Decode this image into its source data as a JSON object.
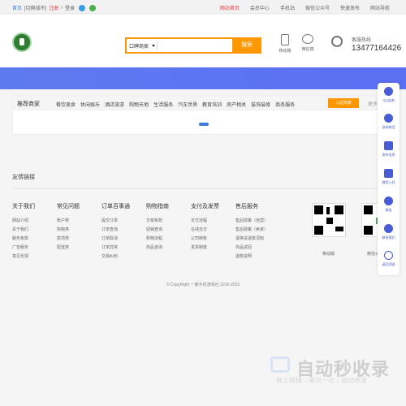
{
  "topbar": {
    "home": "首页",
    "city": "[切换城市]",
    "register": "注册",
    "login": "登录",
    "slash": "/",
    "right": [
      "网站首页",
      "会员中心",
      "手机站",
      "微信公众号",
      "快速发布",
      "网站导航"
    ],
    "colors": {
      "red": "#e4393c",
      "blue": "#3a7bd5"
    }
  },
  "header": {
    "search_select": "口碑商家",
    "search_placeholder": "",
    "search_button": "搜索",
    "apps": [
      {
        "label": "移动端"
      },
      {
        "label": "微信端"
      }
    ],
    "hotline_label": "客服热线",
    "hotline_number": "13477164426",
    "accent": "#ff9800"
  },
  "shops": {
    "title": "推荐商家",
    "categories": [
      "餐饮美食",
      "休闲娱乐",
      "酒店旅游",
      "购物天地",
      "生活服务",
      "汽车世界",
      "教育培训",
      "房产相关",
      "装饰装修",
      "商务服务"
    ],
    "join": "入驻商家",
    "more": "更多"
  },
  "footer": {
    "friend_links": "友情链接",
    "columns": [
      {
        "h": "关于我们",
        "items": [
          "网站介绍",
          "关于我们",
          "服务条款",
          "广告服务",
          "意见反馈"
        ]
      },
      {
        "h": "常见问题",
        "items": [
          "账户类",
          "购物类",
          "款项类",
          "配送类"
        ]
      },
      {
        "h": "订单百事通",
        "items": [
          "提交订单",
          "订单查询",
          "订单取消",
          "订单异常",
          "交易纠纷"
        ]
      },
      {
        "h": "购物指南",
        "items": [
          "交易条款",
          "促销查询",
          "购物流程",
          "商品咨询"
        ]
      },
      {
        "h": "支付及发票",
        "items": [
          "支付流程",
          "在线支付",
          "公司转账",
          "发票制度"
        ]
      },
      {
        "h": "售后服务",
        "items": [
          "售后政策（自营）",
          "售后政策（卖家）",
          "退换货退款须知",
          "商品返回",
          "退款说明"
        ]
      }
    ],
    "qr": [
      {
        "caption": "移动版"
      },
      {
        "caption": "微信公众号"
      }
    ],
    "copyright": "© CopyRight 一都手机游戏社 2015-2023"
  },
  "sidebar": [
    {
      "icon": "qq-icon",
      "label": "QQ咨询"
    },
    {
      "icon": "phone-icon",
      "label": "咨询电话"
    },
    {
      "icon": "send-icon",
      "label": "发布信息"
    },
    {
      "icon": "flag-icon",
      "label": "商家入驻"
    },
    {
      "icon": "wechat-icon",
      "label": "微信"
    },
    {
      "icon": "user-icon",
      "label": "联系我们"
    },
    {
      "icon": "top-icon",
      "label": "返回顶部"
    }
  ],
  "watermark": {
    "main": "自动秒收录",
    "sub": "做上链接→来访一次→自动收录"
  }
}
